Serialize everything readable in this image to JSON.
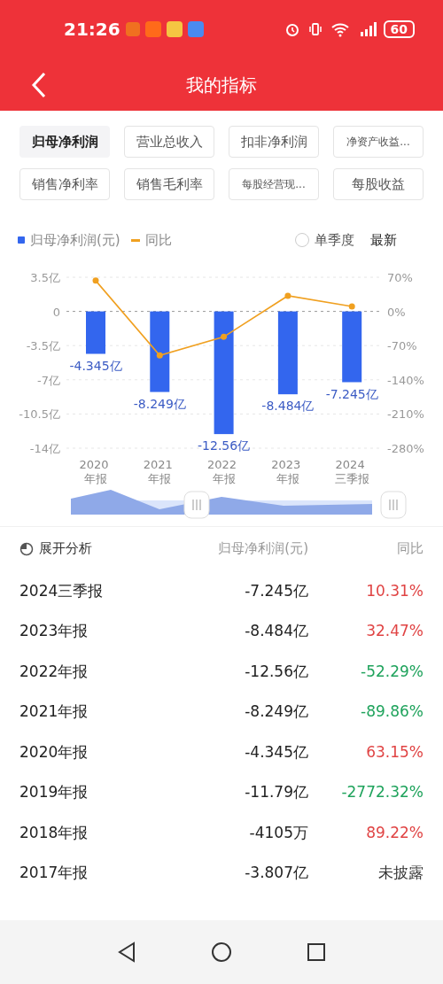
{
  "status_bar": {
    "time": "21:26",
    "battery": "60"
  },
  "header": {
    "title": "我的指标"
  },
  "tabs": [
    {
      "label": "归母净利润",
      "selected": true
    },
    {
      "label": "营业总收入",
      "selected": false
    },
    {
      "label": "扣非净利润",
      "selected": false
    },
    {
      "label": "净资产收益...",
      "selected": false
    },
    {
      "label": "销售净利率",
      "selected": false
    },
    {
      "label": "销售毛利率",
      "selected": false
    },
    {
      "label": "每股经营现...",
      "selected": false
    },
    {
      "label": "每股收益",
      "selected": false
    }
  ],
  "legend": {
    "single_quarter": {
      "label": "单季度",
      "checked": false
    },
    "latest": "最新"
  },
  "chart": {
    "chart_data": {
      "type": "bar",
      "categories": [
        "2020 年报",
        "2021 年报",
        "2022 年报",
        "2023 年报",
        "2024 三季报"
      ],
      "series": [
        {
          "name": "归母净利润(元)",
          "color": "#3366ee",
          "values": [
            -4.345,
            -8.249,
            -12.56,
            -8.484,
            -7.245
          ]
        }
      ],
      "ylim": [
        -14,
        3.5
      ],
      "grid": true,
      "ref_lines": [
        {
          "value": 0,
          "axis": "y"
        }
      ],
      "yticks": [
        {
          "value": 3.5,
          "label": "3.5亿"
        },
        {
          "value": 0,
          "label": "0"
        },
        {
          "value": -3.5,
          "label": "-3.5亿"
        },
        {
          "value": -7,
          "label": "-7亿"
        },
        {
          "value": -10.5,
          "label": "-10.5亿"
        },
        {
          "value": -14,
          "label": "-14亿"
        }
      ],
      "value_labels": [
        "-4.345亿",
        "-8.249亿",
        "-12.56亿",
        "-8.484亿",
        "-7.245亿"
      ]
    }
  },
  "yoy_chart": {
    "chart_data": {
      "type": "line",
      "series": [
        {
          "name": "同比",
          "color": "#f0a020",
          "marker": "circle",
          "values": [
            63,
            -90,
            -52,
            32,
            10
          ]
        }
      ],
      "ylim": [
        -280,
        70
      ],
      "yticks": [
        {
          "value": 70,
          "label": "70%"
        },
        {
          "value": 0,
          "label": "0%"
        },
        {
          "value": -70,
          "label": "-70%"
        },
        {
          "value": -140,
          "label": "-140%"
        },
        {
          "value": -210,
          "label": "-210%"
        },
        {
          "value": -280,
          "label": "-280%"
        }
      ]
    }
  },
  "table": {
    "columns": [
      "展开分析",
      "归母净利润(元)",
      "同比"
    ],
    "rows": [
      {
        "period": "2024三季报",
        "value": "-7.245亿",
        "change": "10.31%",
        "kind": "rise"
      },
      {
        "period": "2023年报",
        "value": "-8.484亿",
        "change": "32.47%",
        "kind": "rise"
      },
      {
        "period": "2022年报",
        "value": "-12.56亿",
        "change": "-52.29%",
        "kind": "fall"
      },
      {
        "period": "2021年报",
        "value": "-8.249亿",
        "change": "-89.86%",
        "kind": "fall"
      },
      {
        "period": "2020年报",
        "value": "-4.345亿",
        "change": "63.15%",
        "kind": "rise"
      },
      {
        "period": "2019年报",
        "value": "-11.79亿",
        "change": "-2772.32%",
        "kind": "fall"
      },
      {
        "period": "2018年报",
        "value": "-4105万",
        "change": "89.22%",
        "kind": "rise"
      },
      {
        "period": "2017年报",
        "value": "-3.807亿",
        "change": "未披露",
        "kind": "none"
      }
    ]
  }
}
